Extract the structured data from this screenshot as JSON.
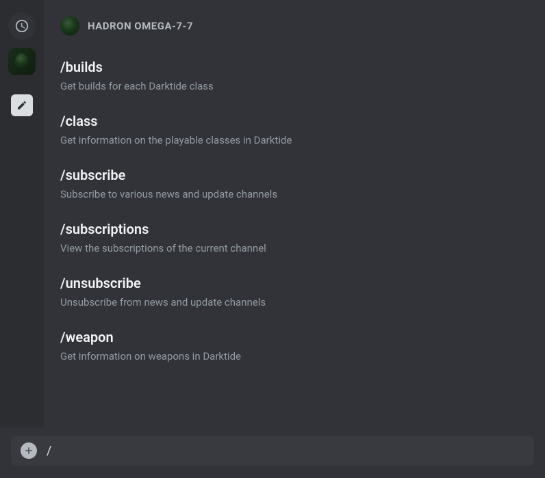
{
  "header": {
    "title": "HADRON OMEGA-7-7"
  },
  "commands": [
    {
      "name": "/builds",
      "desc": "Get builds for each Darktide class"
    },
    {
      "name": "/class",
      "desc": "Get information on the playable classes in Darktide"
    },
    {
      "name": "/subscribe",
      "desc": "Subscribe to various news and update channels"
    },
    {
      "name": "/subscriptions",
      "desc": "View the subscriptions of the current channel"
    },
    {
      "name": "/unsubscribe",
      "desc": "Unsubscribe from news and update channels"
    },
    {
      "name": "/weapon",
      "desc": "Get information on weapons in Darktide"
    }
  ],
  "input": {
    "value": "/"
  }
}
